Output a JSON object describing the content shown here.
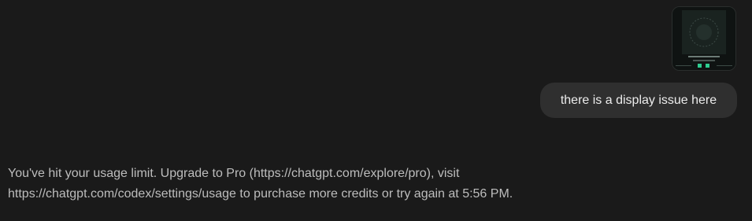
{
  "conversation": {
    "user_message": {
      "attachment": {
        "type": "image",
        "icon": "image-thumbnail",
        "accent_color": "#2ecc8f"
      },
      "text": "there is a display issue here"
    },
    "assistant_message": {
      "lines": [
        "You've hit your usage limit. Upgrade to Pro (https://chatgpt.com/explore/pro), visit",
        "https://chatgpt.com/codex/settings/usage to purchase more credits or try again at 5:56 PM."
      ]
    }
  },
  "colors": {
    "background": "#1a1a1a",
    "user_bubble": "#2f2f2f",
    "user_text": "#ececec",
    "assistant_text": "#bdbdbd"
  }
}
